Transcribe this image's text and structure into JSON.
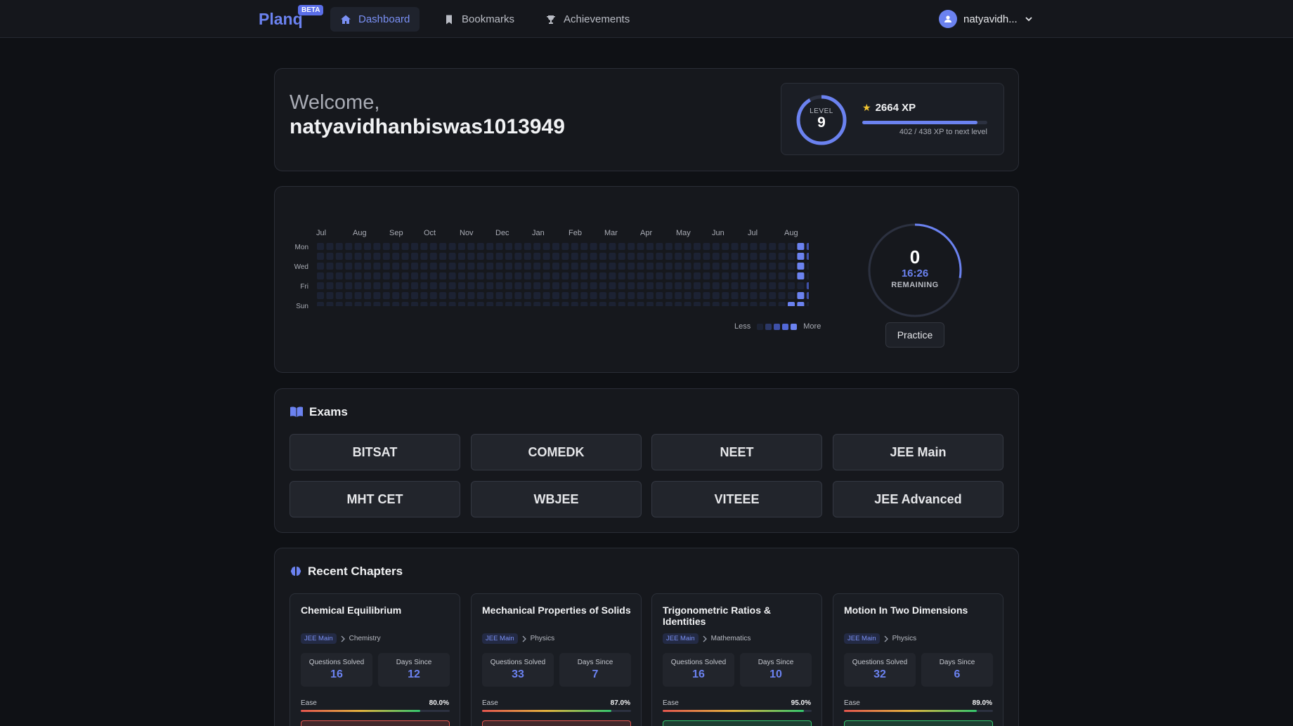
{
  "nav": {
    "brand": "Planq",
    "beta": "BETA",
    "items": [
      {
        "label": "Dashboard",
        "icon": "home-icon",
        "active": true
      },
      {
        "label": "Bookmarks",
        "icon": "bookmark-icon",
        "active": false
      },
      {
        "label": "Achievements",
        "icon": "trophy-icon",
        "active": false
      }
    ],
    "user": "natyavidh..."
  },
  "welcome": {
    "greeting": "Welcome,",
    "username": "natyavidhanbiswas1013949",
    "level_label": "LEVEL",
    "level": "9",
    "xp": "2664 XP",
    "xp_progress": "402 / 438 XP to next level",
    "xp_fraction": 0.918
  },
  "activity": {
    "months": [
      "Jul",
      "Aug",
      "Sep",
      "Oct",
      "Nov",
      "Dec",
      "Jan",
      "Feb",
      "Mar",
      "Apr",
      "May",
      "Jun",
      "Jul",
      "Aug"
    ],
    "days": [
      "Mon",
      "Wed",
      "Fri",
      "Sun"
    ],
    "legend_less": "Less",
    "legend_more": "More",
    "colors": [
      "#1c2233",
      "#2b3766",
      "#3e50a8",
      "#5268d6",
      "#6b82f0"
    ]
  },
  "timer": {
    "count": "0",
    "time": "16:26",
    "label": "REMAINING",
    "practice": "Practice"
  },
  "exams": {
    "title": "Exams",
    "items": [
      "BITSAT",
      "COMEDK",
      "NEET",
      "JEE Main",
      "MHT CET",
      "WBJEE",
      "VITEEE",
      "JEE Advanced"
    ]
  },
  "chapters": {
    "title": "Recent Chapters",
    "items": [
      {
        "name": "Chemical Equilibrium",
        "exam": "JEE Main",
        "subject": "Chemistry",
        "solved_label": "Questions Solved",
        "solved": "16",
        "days_label": "Days Since",
        "days": "12",
        "ease_label": "Ease",
        "ease": "80.0%",
        "ease_value": 0.8,
        "accent": "#e2554d"
      },
      {
        "name": "Mechanical Properties of Solids",
        "exam": "JEE Main",
        "subject": "Physics",
        "solved_label": "Questions Solved",
        "solved": "33",
        "days_label": "Days Since",
        "days": "7",
        "ease_label": "Ease",
        "ease": "87.0%",
        "ease_value": 0.87,
        "accent": "#e2554d"
      },
      {
        "name": "Trigonometric Ratios & Identities",
        "exam": "JEE Main",
        "subject": "Mathematics",
        "solved_label": "Questions Solved",
        "solved": "16",
        "days_label": "Days Since",
        "days": "10",
        "ease_label": "Ease",
        "ease": "95.0%",
        "ease_value": 0.95,
        "accent": "#33c46c"
      },
      {
        "name": "Motion In Two Dimensions",
        "exam": "JEE Main",
        "subject": "Physics",
        "solved_label": "Questions Solved",
        "solved": "32",
        "days_label": "Days Since",
        "days": "6",
        "ease_label": "Ease",
        "ease": "89.0%",
        "ease_value": 0.89,
        "accent": "#33c46c"
      }
    ]
  }
}
